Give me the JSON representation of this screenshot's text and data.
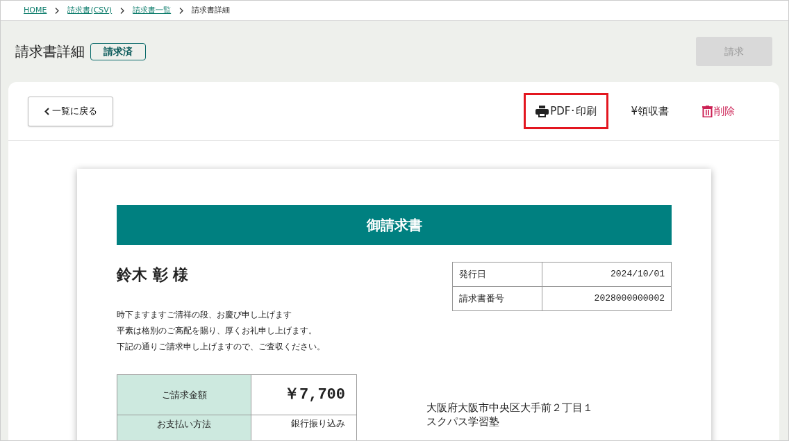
{
  "breadcrumb": [
    {
      "label": "HOME",
      "link": true
    },
    {
      "label": "請求書(CSV)",
      "link": true
    },
    {
      "label": "請求書一覧",
      "link": true
    },
    {
      "label": "請求書詳細",
      "link": false
    }
  ],
  "page": {
    "title": "請求書詳細",
    "status_badge": "請求済",
    "action_button": {
      "label": "請求",
      "disabled": true
    }
  },
  "toolbar": {
    "back_button": "一覧に戻る",
    "actions": [
      {
        "kind": "print",
        "label": "PDF･印刷",
        "highlighted": true
      },
      {
        "kind": "receipt",
        "label": "¥領収書",
        "highlighted": false
      },
      {
        "kind": "delete",
        "label": "削除",
        "highlighted": false
      }
    ]
  },
  "invoice": {
    "heading": "御請求書",
    "recipient": "鈴木 彰 様",
    "greeting": [
      "時下ますますご清祥の段、お慶び申し上げます",
      "平素は格別のご高配を賜り、厚くお礼申し上げます。",
      "下記の通りご請求申し上げますので、ご査収ください。"
    ],
    "meta": [
      {
        "label": "発行日",
        "value": "2024/10/01"
      },
      {
        "label": "請求書番号",
        "value": "2028000000002"
      }
    ],
    "summary": [
      {
        "label": "ご請求金額",
        "value": "￥7,700",
        "emphasis": true
      },
      {
        "label": "お支払い方法",
        "value": "銀行振り込み",
        "emphasis": false
      }
    ],
    "issuer": [
      "大阪府大阪市中央区大手前２丁目１",
      "スクパス学習塾"
    ]
  }
}
